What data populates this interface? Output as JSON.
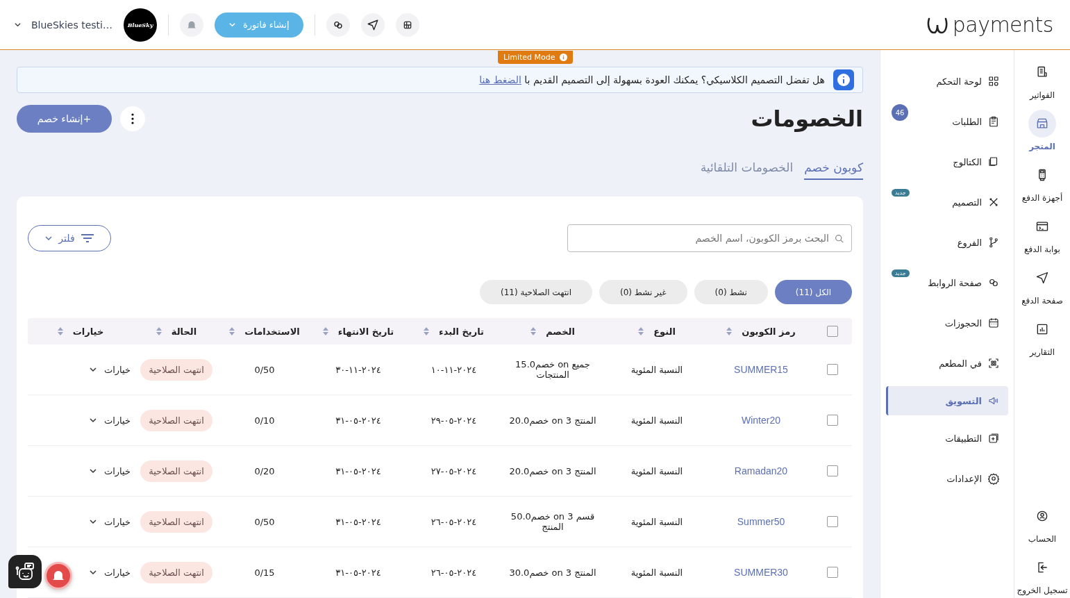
{
  "top_bar": {
    "logo_text": "payments",
    "account": {
      "name": "BlueSkies testi…",
      "logo_text": "BlueSky"
    },
    "create_invoice_button": "إنشاء فاتورة"
  },
  "limited_badge": "Limited Mode",
  "banner": {
    "text": "هل تفضل التصميم الكلاسيكي؟ يمكنك العودة بسهولة إلى التصميم القديم با",
    "link": "الضغط هنا"
  },
  "page": {
    "title": "الخصومات",
    "create_button": "+إنشاء خصم"
  },
  "tabs": [
    {
      "label": "كوبون خصم",
      "selected": true
    },
    {
      "label": "الخصومات التلقائية",
      "selected": false
    }
  ],
  "search": {
    "placeholder": "البحث برمز الكوبون، اسم الخصم"
  },
  "filter_button": "فلتر",
  "status_filters": [
    {
      "label": "الكل (11)",
      "selected": true
    },
    {
      "label": "نشط (0)",
      "selected": false
    },
    {
      "label": "غير نشط (0)",
      "selected": false
    },
    {
      "label": "انتهت الصلاحية (11)",
      "selected": false
    }
  ],
  "table": {
    "select_all_checked": false,
    "columns": [
      "رمز الكوبون",
      "النوع",
      "الخصم",
      "تاريخ البدء",
      "تاريخ الانتهاء",
      "الاستخدامات",
      "الحالة",
      "خيارات"
    ],
    "rows": [
      {
        "checked": false,
        "code": "SUMMER15",
        "type": "النسبة المئوية",
        "discount": "15.0خصم on جميع المنتجات",
        "start": "٢٠٢٤-١١-١٠",
        "end": "٢٠٢٤-١١-٣٠",
        "uses": "0/50",
        "status": {
          "label": "انتهت الصلاحية",
          "kind": "expired"
        },
        "options": "خيارات"
      },
      {
        "checked": false,
        "code": "Winter20",
        "type": "النسبة المئوية",
        "discount": "20.0خصم on 3 المنتج",
        "start": "٢٠٢٤-٠٥-٢٩",
        "end": "٢٠٢٤-٠٥-٣١",
        "uses": "0/10",
        "status": {
          "label": "انتهت الصلاحية",
          "kind": "expired"
        },
        "options": "خيارات"
      },
      {
        "checked": false,
        "code": "Ramadan20",
        "type": "النسبة المئوية",
        "discount": "20.0خصم on 3 المنتج",
        "start": "٢٠٢٤-٠٥-٢٧",
        "end": "٢٠٢٤-٠٥-٣١",
        "uses": "0/20",
        "status": {
          "label": "انتهت الصلاحية",
          "kind": "expired"
        },
        "options": "خيارات"
      },
      {
        "checked": false,
        "code": "Summer50",
        "type": "النسبة المئوية",
        "discount": "50.0خصم on 3 قسم المنتج",
        "start": "٢٠٢٤-٠٥-٢٦",
        "end": "٢٠٢٤-٠٥-٣١",
        "uses": "0/50",
        "status": {
          "label": "انتهت الصلاحية",
          "kind": "expired"
        },
        "options": "خيارات"
      },
      {
        "checked": false,
        "code": "SUMMER30",
        "type": "النسبة المئوية",
        "discount": "30.0خصم on 3 المنتج",
        "start": "٢٠٢٤-٠٥-٢٦",
        "end": "٢٠٢٤-٠٥-٣١",
        "uses": "0/15",
        "status": {
          "label": "انتهت الصلاحية",
          "kind": "expired"
        },
        "options": "خيارات"
      }
    ]
  },
  "nav_rail": {
    "items": [
      {
        "label": "الفواتير",
        "selected": false
      },
      {
        "label": "المتجر",
        "selected": true
      },
      {
        "label": "أجهزة الدفع",
        "selected": false
      },
      {
        "label": "بوابة الدفع",
        "selected": false
      },
      {
        "label": "صفحة الدفع",
        "selected": false
      },
      {
        "label": "التقارير",
        "selected": false
      }
    ],
    "bottom_items": [
      {
        "label": "الحساب"
      },
      {
        "label": "تسجيل الخروج"
      }
    ]
  },
  "sub_nav": {
    "items": [
      {
        "label": "لوحة التحكم",
        "selected": false
      },
      {
        "label": "الطلبات",
        "selected": false,
        "badge": {
          "text": "46",
          "kind": "count"
        }
      },
      {
        "label": "الكتالوج",
        "selected": false
      },
      {
        "label": "التصميم",
        "selected": false,
        "badge": {
          "text": "جديد",
          "kind": "new"
        }
      },
      {
        "label": "الفروع",
        "selected": false
      },
      {
        "label": "صفحة الروابط",
        "selected": false,
        "badge": {
          "text": "جديد",
          "kind": "new"
        }
      },
      {
        "label": "الحجوزات",
        "selected": false
      },
      {
        "label": "في المطعم",
        "selected": false
      },
      {
        "label": "التسويق",
        "selected": true
      },
      {
        "label": "التطبيقات",
        "selected": false
      },
      {
        "label": "الإعدادات",
        "selected": false
      }
    ]
  }
}
